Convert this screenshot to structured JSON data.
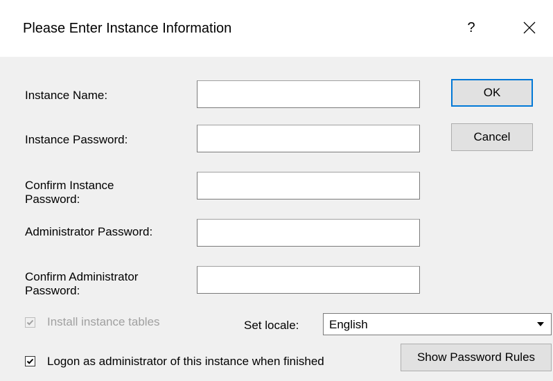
{
  "window": {
    "title": "Please Enter Instance Information",
    "help_label": "?"
  },
  "form": {
    "instance_name_label": "Instance Name:",
    "instance_password_label": "Instance Password:",
    "confirm_instance_password_label_line1": "Confirm Instance",
    "confirm_instance_password_label_line2": "Password:",
    "admin_password_label": "Administrator Password:",
    "confirm_admin_password_label_line1": "Confirm Administrator",
    "confirm_admin_password_label_line2": "Password:",
    "instance_name_value": "",
    "instance_password_value": "",
    "confirm_instance_password_value": "",
    "admin_password_value": "",
    "confirm_admin_password_value": ""
  },
  "buttons": {
    "ok": "OK",
    "cancel": "Cancel",
    "show_password_rules": "Show Password Rules"
  },
  "options": {
    "install_tables_label": "Install instance tables",
    "install_tables_checked": true,
    "install_tables_enabled": false,
    "logon_label": "Logon as administrator of this instance when finished",
    "logon_checked": true,
    "locale_label": "Set locale:",
    "locale_value": "English"
  },
  "colors": {
    "client_bg": "#f0f0f0",
    "default_button_border": "#0078d7",
    "disabled_text": "#a0a0a0"
  }
}
